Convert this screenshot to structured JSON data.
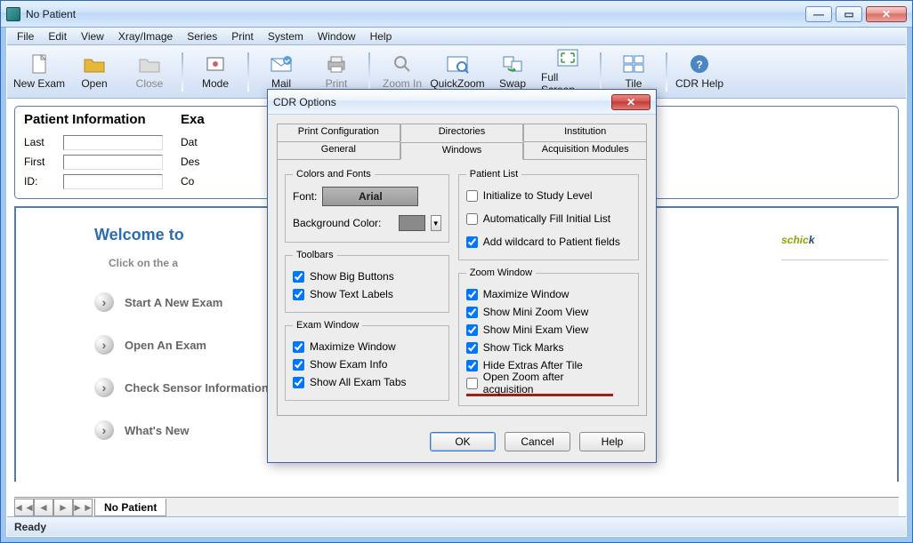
{
  "window": {
    "title": "No Patient"
  },
  "menu": [
    "File",
    "Edit",
    "View",
    "Xray/Image",
    "Series",
    "Print",
    "System",
    "Window",
    "Help"
  ],
  "toolbar": [
    {
      "label": "New Exam",
      "icon": "doc",
      "disabled": false
    },
    {
      "label": "Open",
      "icon": "folder",
      "disabled": false
    },
    {
      "label": "Close",
      "icon": "folderx",
      "disabled": true
    },
    {
      "sep": true
    },
    {
      "label": "Mode",
      "icon": "mode",
      "disabled": false
    },
    {
      "sep": true
    },
    {
      "label": "Mail",
      "icon": "mail",
      "disabled": false
    },
    {
      "label": "Print",
      "icon": "print",
      "disabled": true
    },
    {
      "sep": true
    },
    {
      "label": "Zoom In",
      "icon": "zoom",
      "disabled": true
    },
    {
      "label": "QuickZoom",
      "icon": "qzoom",
      "disabled": false
    },
    {
      "label": "Swap",
      "icon": "swap",
      "disabled": false
    },
    {
      "label": "Full Screen",
      "icon": "full",
      "disabled": false
    },
    {
      "sep": true
    },
    {
      "label": "Tile",
      "icon": "tile",
      "disabled": false
    },
    {
      "sep": true
    },
    {
      "label": "CDR Help",
      "icon": "help",
      "disabled": false
    }
  ],
  "patient_info": {
    "title": "Patient Information",
    "last": "Last",
    "first": "First",
    "id": "ID:"
  },
  "exam_info": {
    "title": "Exa",
    "date": "Dat",
    "desc": "Des",
    "cond": "Co"
  },
  "welcome": {
    "title": "Welcome to",
    "sub": "Click on the a",
    "items": [
      "Start A New Exam",
      "Open An Exam",
      "Check Sensor Information",
      "What's New"
    ]
  },
  "tab_name": "No Patient",
  "status": "Ready",
  "logo": {
    "a": "schic",
    "b": "k"
  },
  "dialog": {
    "title": "CDR Options",
    "tabs_row1": [
      "Print Configuration",
      "Directories",
      "Institution"
    ],
    "tabs_row2": [
      "General",
      "Windows",
      "Acquisition Modules"
    ],
    "active_tab": "Windows",
    "colors_fonts": {
      "legend": "Colors and Fonts",
      "font_label": "Font:",
      "font_value": "Arial",
      "bg_label": "Background Color:"
    },
    "toolbars": {
      "legend": "Toolbars",
      "big": "Show Big Buttons",
      "text": "Show Text Labels",
      "big_v": true,
      "text_v": true
    },
    "examwin": {
      "legend": "Exam Window",
      "max": "Maximize Window",
      "info": "Show Exam Info",
      "tabs": "Show All Exam Tabs",
      "max_v": true,
      "info_v": true,
      "tabs_v": true
    },
    "plist": {
      "legend": "Patient List",
      "a": "Initialize to Study Level",
      "b": "Automatically Fill Initial List",
      "c": "Add wildcard to Patient fields",
      "a_v": false,
      "b_v": false,
      "c_v": true
    },
    "zoom": {
      "legend": "Zoom Window",
      "a": "Maximize Window",
      "b": "Show Mini Zoom View",
      "c": "Show Mini Exam View",
      "d": "Show Tick Marks",
      "e": "Hide Extras After Tile",
      "f": "Open Zoom after acquisition",
      "a_v": true,
      "b_v": true,
      "c_v": true,
      "d_v": true,
      "e_v": true,
      "f_v": false
    },
    "buttons": {
      "ok": "OK",
      "cancel": "Cancel",
      "help": "Help"
    }
  }
}
